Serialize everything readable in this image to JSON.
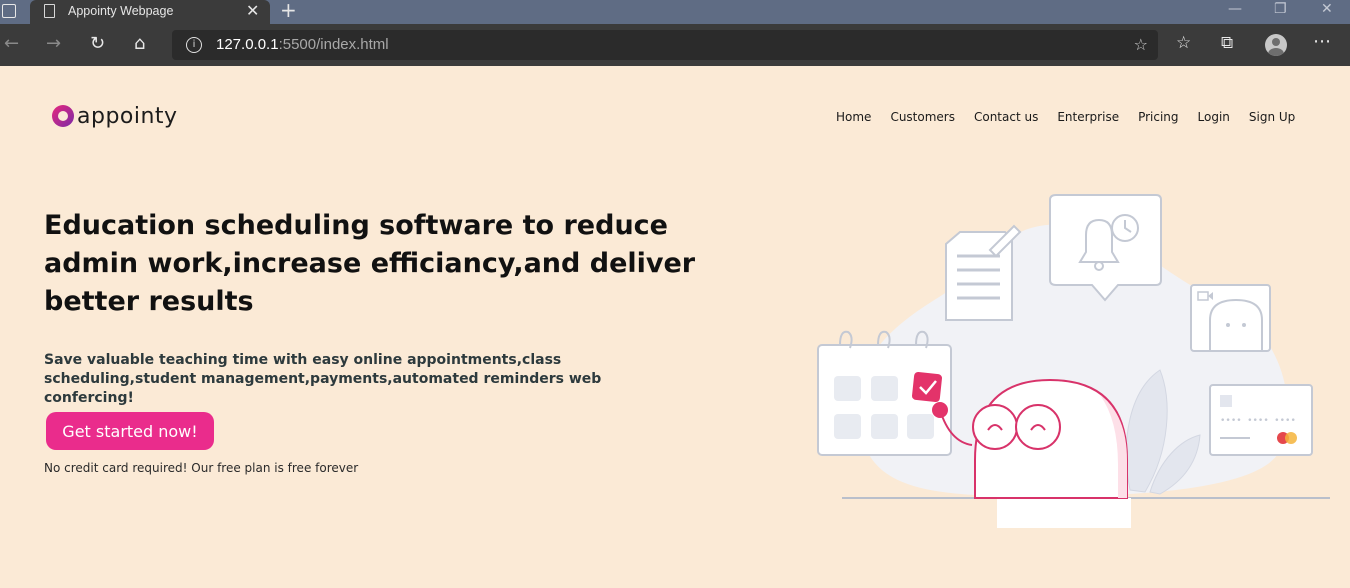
{
  "browser": {
    "tab_title": "Appointy Webpage",
    "url_host": "127.0.0.1",
    "url_path": ":5500/index.html"
  },
  "brand": {
    "logo_text": "appointy"
  },
  "nav": [
    "Home",
    "Customers",
    "Contact us",
    "Enterprise",
    "Pricing",
    "Login",
    "Sign Up"
  ],
  "hero": {
    "headline": "Education scheduling software to reduce admin work,increase efficiancy,and deliver better results",
    "subhead": "Save valuable teaching time with easy online appointments,class scheduling,student management,payments,automated reminders web confercing!",
    "cta_label": "Get started now!",
    "note": "No credit card required! Our free plan is free forever"
  },
  "colors": {
    "page_bg": "#fbead6",
    "accent": "#ea2c8c",
    "tabbar": "#5f6c84",
    "toolbar": "#3b3b3b"
  }
}
